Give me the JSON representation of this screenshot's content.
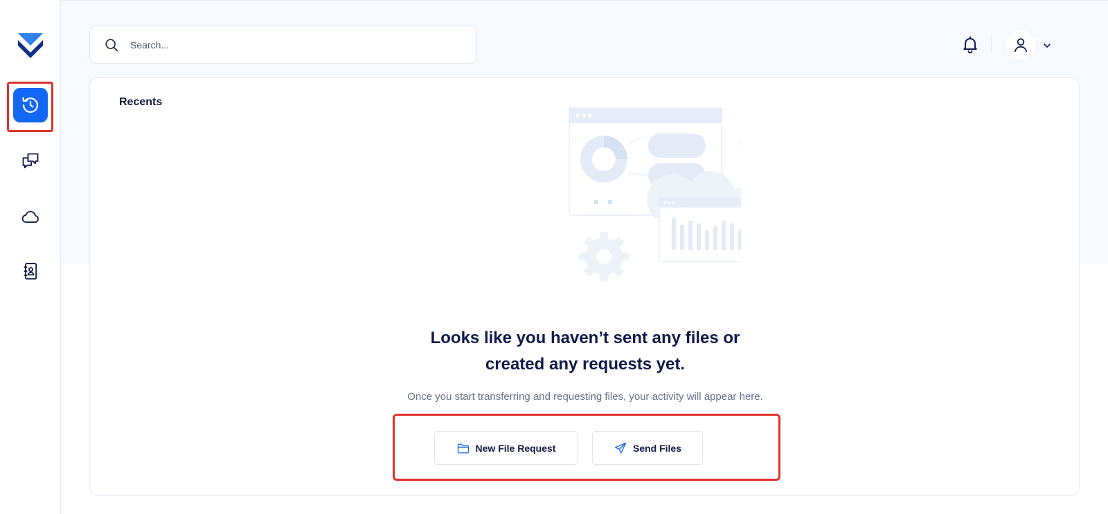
{
  "header": {
    "search_placeholder": "Search..."
  },
  "sidebar": {
    "items": [
      {
        "icon": "history-icon",
        "active": true
      },
      {
        "icon": "chat-icon",
        "active": false
      },
      {
        "icon": "cloud-icon",
        "active": false
      },
      {
        "icon": "contacts-icon",
        "active": false
      }
    ]
  },
  "main": {
    "section_title": "Recents",
    "empty_heading_line1": "Looks like you haven’t sent any files or",
    "empty_heading_line2": "created any requests yet.",
    "empty_subtitle": "Once you start transferring and requesting files, your activity will appear here.",
    "new_file_request_label": "New File Request",
    "send_files_label": "Send Files"
  },
  "colors": {
    "accent": "#1466f5",
    "highlight": "#e0312b",
    "text_dark": "#0e1a4a",
    "band_bg": "#f6f9fd"
  }
}
